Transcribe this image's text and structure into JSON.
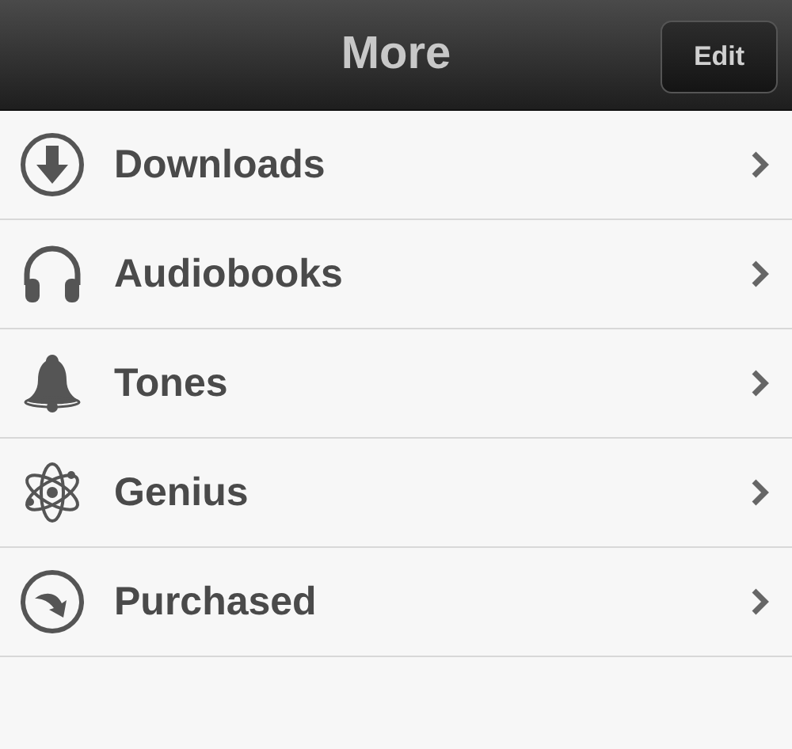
{
  "nav_bar": {
    "title": "More",
    "edit_button": "Edit"
  },
  "items": [
    {
      "label": "Downloads",
      "kind": "download"
    },
    {
      "label": "Audiobooks",
      "kind": "headphones"
    },
    {
      "label": "Tones",
      "kind": "bell"
    },
    {
      "label": "Genius",
      "kind": "atom"
    },
    {
      "label": "Purchased",
      "kind": "purchased"
    }
  ]
}
